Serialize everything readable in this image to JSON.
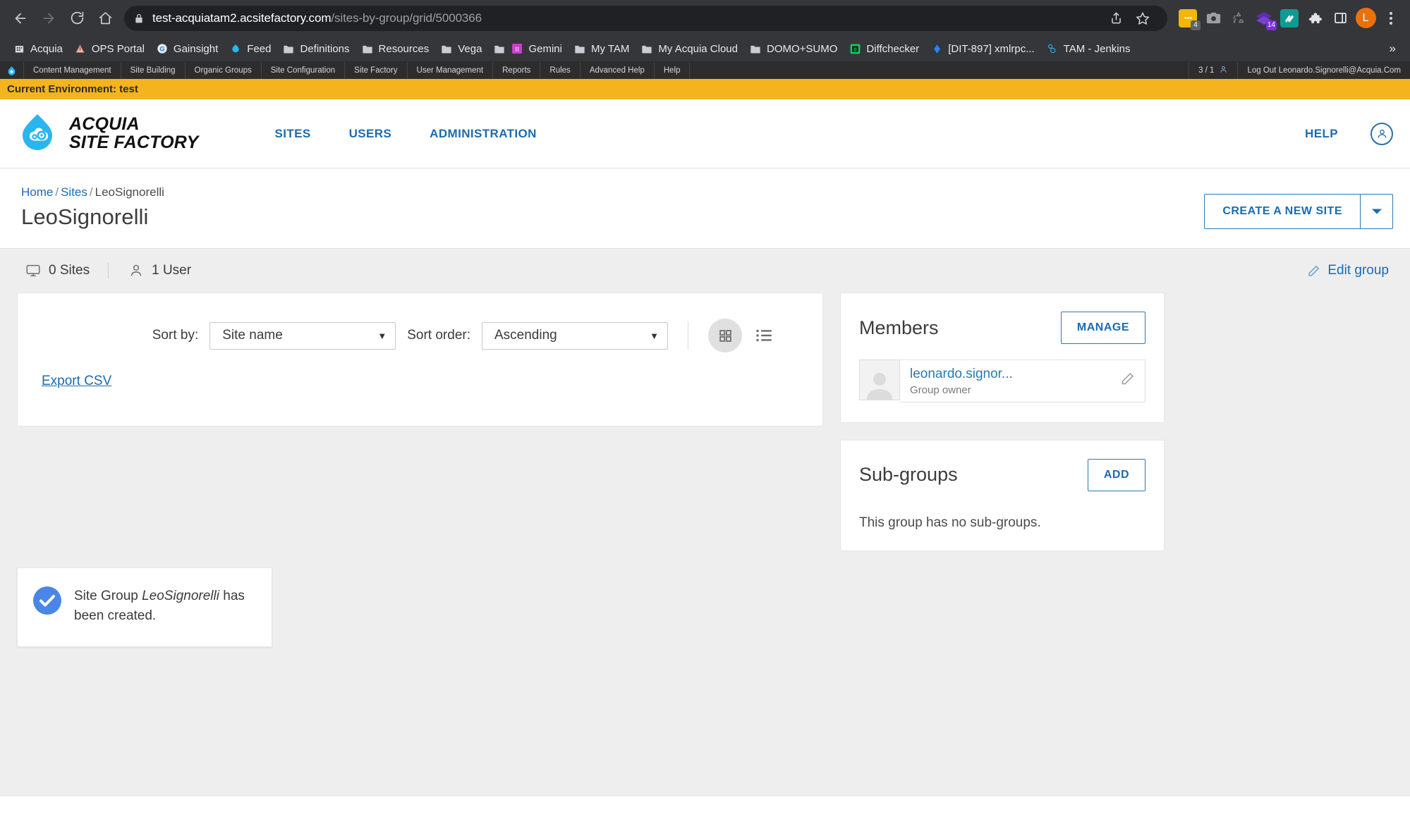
{
  "browser": {
    "url_domain": "test-acquiatam2.acsitefactory.com",
    "url_path": "/sites-by-group/grid/5000366",
    "nav": {
      "back": "back-arrow",
      "forward": "forward-arrow",
      "reload": "reload",
      "home": "home"
    },
    "extensions": [
      {
        "name": "notes-extension",
        "badge": "4"
      },
      {
        "name": "camera-extension",
        "badge": ""
      },
      {
        "name": "recycle-extension",
        "badge": ""
      },
      {
        "name": "purple-diamond-extension",
        "badge": "14"
      },
      {
        "name": "teal-books-extension",
        "badge": ""
      },
      {
        "name": "puzzle-extensions-icon",
        "badge": ""
      },
      {
        "name": "side-panel-icon",
        "badge": ""
      }
    ],
    "profile_initial": "L",
    "bookmarks": [
      {
        "label": "Acquia",
        "icon": "building-icon"
      },
      {
        "label": "OPS Portal",
        "icon": "ops-icon"
      },
      {
        "label": "Gainsight",
        "icon": "gainsight-icon"
      },
      {
        "label": "Feed",
        "icon": "feed-icon"
      },
      {
        "label": "Definitions",
        "icon": "folder-icon"
      },
      {
        "label": "Resources",
        "icon": "folder-icon"
      },
      {
        "label": "Vega",
        "icon": "folder-icon"
      },
      {
        "label": "Gemini",
        "icon": "gemini-icon"
      },
      {
        "label": "My TAM",
        "icon": "folder-icon"
      },
      {
        "label": "My Acquia Cloud",
        "icon": "folder-icon"
      },
      {
        "label": "DOMO+SUMO",
        "icon": "folder-icon"
      },
      {
        "label": "Diffchecker",
        "icon": "diffchecker-icon"
      },
      {
        "label": "[DIT-897] xmlrpc...",
        "icon": "jira-icon"
      },
      {
        "label": "TAM - Jenkins",
        "icon": "jenkins-icon"
      }
    ],
    "bookmarks_overflow": "»"
  },
  "admin_toolbar": {
    "items": [
      "Content Management",
      "Site Building",
      "Organic Groups",
      "Site Configuration",
      "Site Factory",
      "User Management",
      "Reports",
      "Rules",
      "Advanced Help",
      "Help"
    ],
    "user_count": "3 / 1",
    "logout": "Log Out Leonardo.Signorelli@Acquia.Com"
  },
  "env_banner": {
    "text": "Current Environment: test"
  },
  "site_header": {
    "logo_line1": "ACQUIA",
    "logo_line2": "SITE FACTORY",
    "nav": [
      "SITES",
      "USERS",
      "ADMINISTRATION"
    ],
    "help": "HELP",
    "account_icon": "user-circle-icon"
  },
  "page": {
    "breadcrumb": {
      "home": "Home",
      "sites": "Sites",
      "current": "LeoSignorelli",
      "separator": "/"
    },
    "title": "LeoSignorelli",
    "create_button": "CREATE A NEW SITE"
  },
  "stats": {
    "sites": "0 Sites",
    "users": "1 User",
    "edit_group": "Edit group"
  },
  "toolbar": {
    "sort_by_label": "Sort by:",
    "sort_by_value": "Site name",
    "sort_order_label": "Sort order:",
    "sort_order_value": "Ascending",
    "grid_view": "grid-view-icon",
    "list_view": "list-view-icon",
    "export_csv": "Export CSV"
  },
  "members_panel": {
    "title": "Members",
    "button": "MANAGE",
    "member": {
      "name": "leonardo.signor...",
      "role": "Group owner"
    }
  },
  "subgroups_panel": {
    "title": "Sub-groups",
    "button": "ADD",
    "empty_text": "This group has no sub-groups."
  },
  "toast": {
    "prefix": "Site Group ",
    "emphasis": "LeoSignorelli",
    "suffix": " has been created."
  },
  "colors": {
    "accent_blue": "#1b6bb0",
    "env_yellow": "#f5b41d",
    "toast_blue": "#4a86e8",
    "chrome_dark": "#35363a"
  }
}
